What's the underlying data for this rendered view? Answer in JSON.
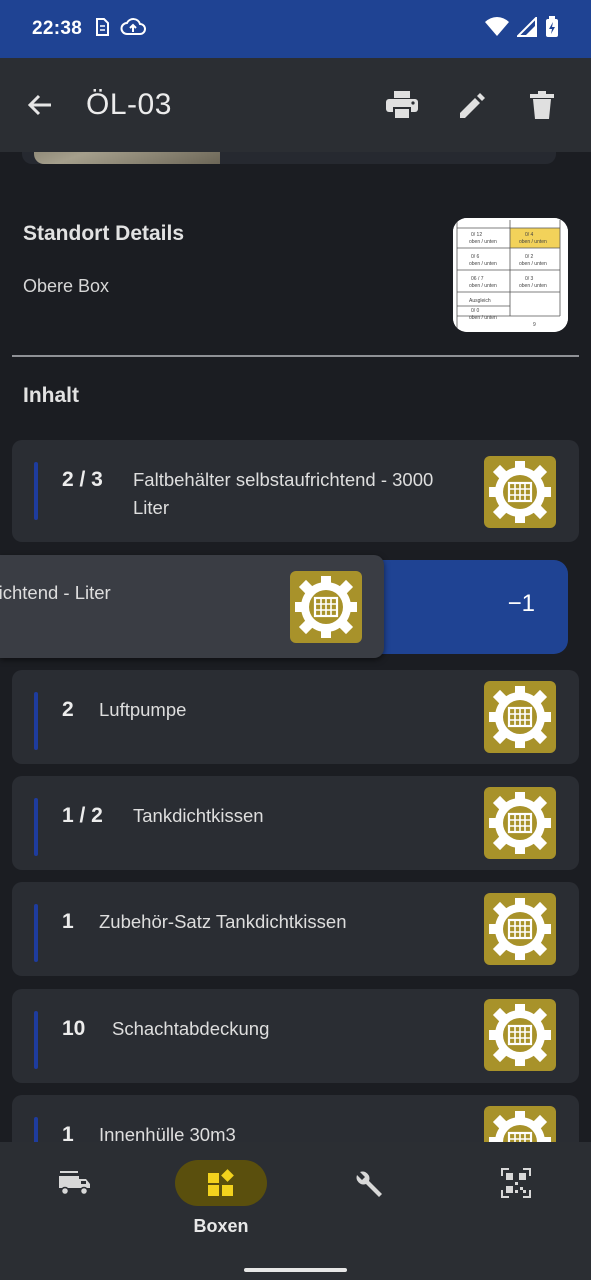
{
  "status_bar": {
    "time": "22:38"
  },
  "app_bar": {
    "title": "ÖL-03"
  },
  "standort": {
    "title": "Standort Details",
    "subtitle": "Obere Box"
  },
  "inhalt": {
    "title": "Inhalt"
  },
  "items": [
    {
      "qty": "2 / 3",
      "name": "Faltbehälter selbstaufrichtend - 3000 Liter"
    },
    {
      "qty": "",
      "name": "hälter selbstaufrichtend - Liter",
      "swipe_label": "−1"
    },
    {
      "qty": "2",
      "name": "Luftpumpe"
    },
    {
      "qty": "1 / 2",
      "name": "Tankdichtkissen"
    },
    {
      "qty": "1",
      "name": "Zubehör-Satz Tankdichtkissen"
    },
    {
      "qty": "10",
      "name": "Schachtabdeckung"
    },
    {
      "qty": "1",
      "name": "Innenhülle 30m3"
    }
  ],
  "bottom_nav": {
    "active_label": "Boxen",
    "items": [
      "vehicle-icon",
      "boxes-icon",
      "wrench-icon",
      "qr-code-icon"
    ]
  },
  "colors": {
    "status_bar": "#1f4393",
    "accent_blue": "#1e3c9e",
    "item_icon_bg": "#a8922a",
    "nav_active": "#5a4f0d"
  }
}
